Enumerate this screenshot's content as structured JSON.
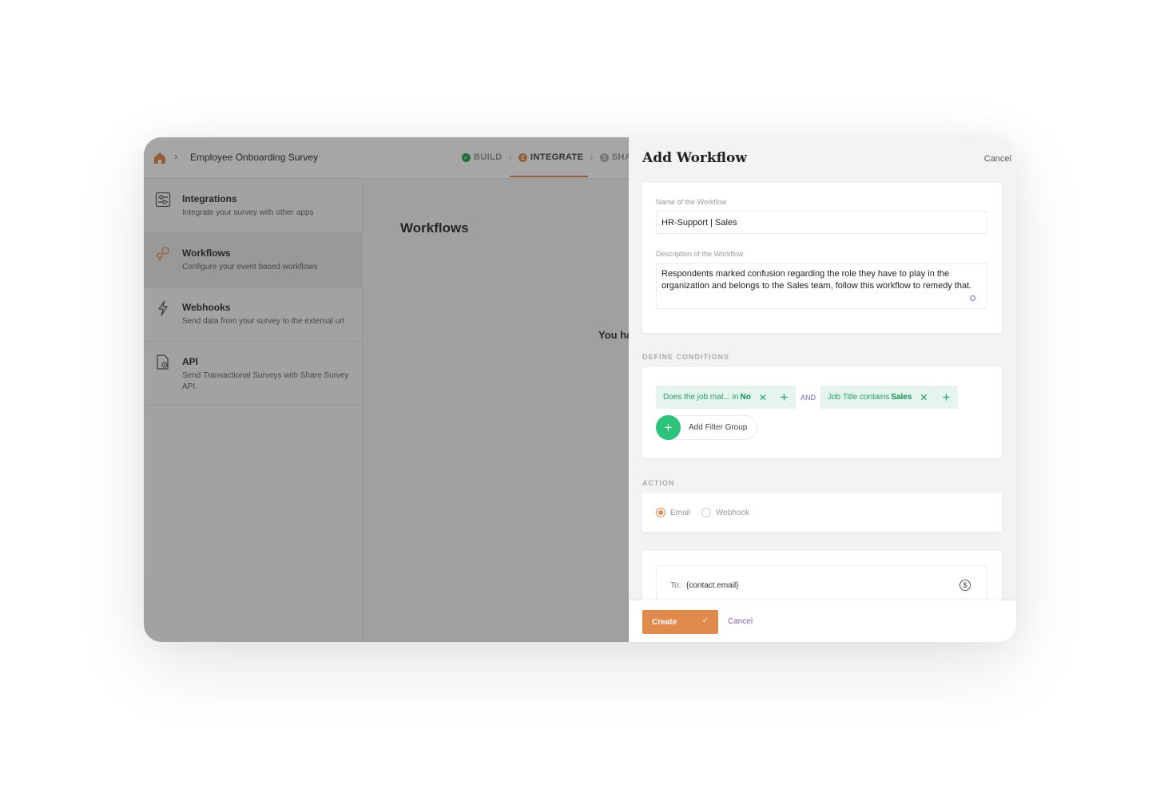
{
  "topbar": {
    "survey_title": "Employee Onboarding Survey",
    "steps": [
      {
        "label": "BUILD",
        "marker": "✓"
      },
      {
        "label": "INTEGRATE",
        "marker": "2"
      },
      {
        "label": "SHA",
        "marker": "3"
      }
    ]
  },
  "sidebar": {
    "items": [
      {
        "title": "Integrations",
        "desc": "Integrate your survey with other apps"
      },
      {
        "title": "Workflows",
        "desc": "Configure your event based workflows"
      },
      {
        "title": "Webhooks",
        "desc": "Send data from your survey to the external url"
      },
      {
        "title": "API",
        "desc": "Send Transactional Surveys with Share Survey API."
      }
    ]
  },
  "main": {
    "title": "Workflows",
    "empty_text": "You ha"
  },
  "drawer": {
    "title": "Add Workflow",
    "cancel_label": "Cancel",
    "name_label": "Name of the Workflow",
    "name_value": "HR-Support | Sales",
    "desc_label": "Description of the Workflow",
    "desc_value": "Respondents marked confusion regarding the role they have to play in the organization and belongs to the Sales team, follow this workflow to remedy that.",
    "conditions_label": "DEFINE CONDITIONS",
    "chip1_prefix": "Does the job mat... in",
    "chip1_value": "No",
    "and_label": "AND",
    "chip2_prefix": "Job Title contains",
    "chip2_value": "Sales",
    "add_filter_group": "Add Filter Group",
    "action_label": "ACTION",
    "action_options": [
      "Email",
      "Webhook"
    ],
    "action_selected": "Email",
    "to_label": "To:",
    "to_value": "{contact.email}",
    "create_label": "Create",
    "footer_cancel": "Cancel"
  },
  "colors": {
    "accent": "#e08a4e",
    "success": "#2aa55c",
    "chip_bg": "#e5f5ee",
    "chip_text": "#1f9e63",
    "link": "#7a5fb5"
  }
}
